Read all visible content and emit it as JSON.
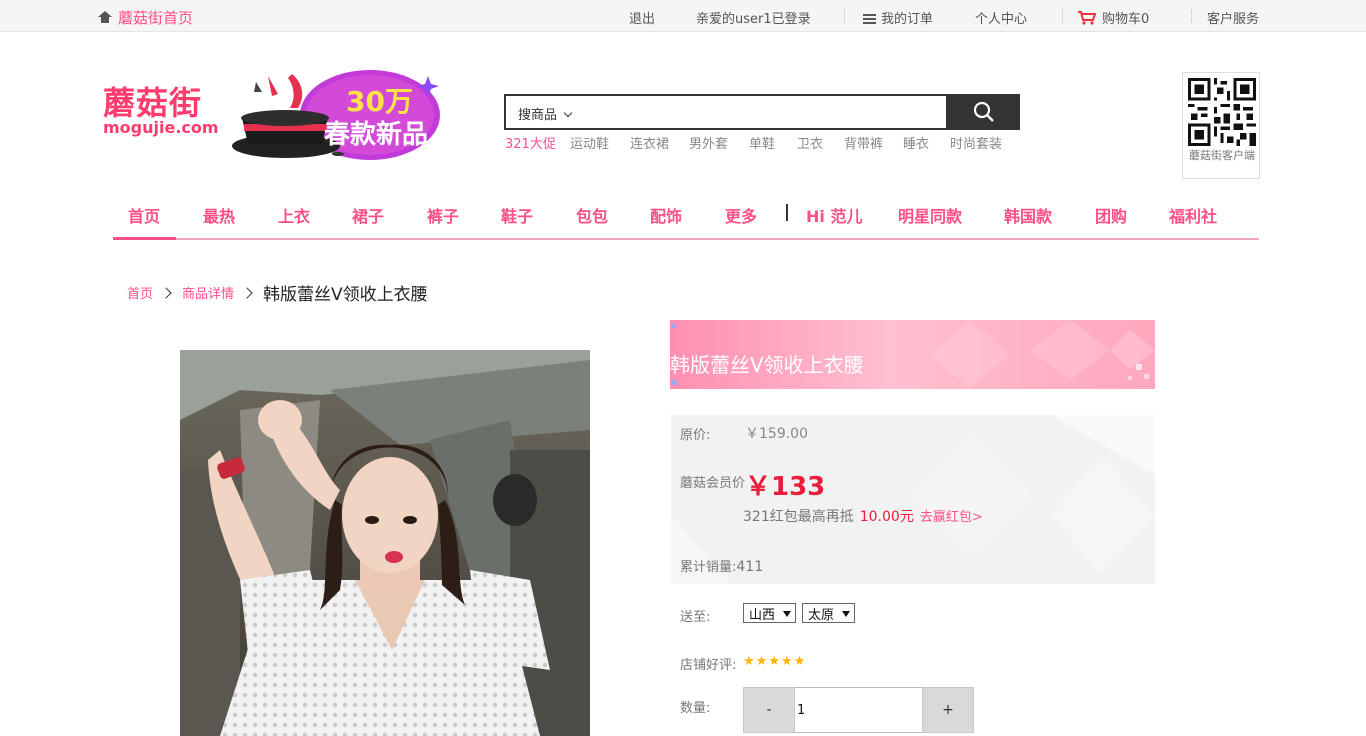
{
  "topbar": {
    "home_label": "蘑菇街首页",
    "logout": "退出",
    "greeting": "亲爱的user1已登录",
    "my_orders": "我的订单",
    "user_center": "个人中心",
    "cart": "购物车0",
    "customer_service": "客户服务"
  },
  "header": {
    "logo_cn": "蘑菇街",
    "logo_en": "mogujie.com",
    "promo_line1": "30万",
    "promo_line2": "春款新品",
    "search_scope": "搜商品",
    "hot_words": [
      "321大促",
      "运动鞋",
      "连衣裙",
      "男外套",
      "单鞋",
      "卫衣",
      "背带裤",
      "睡衣",
      "时尚套装"
    ],
    "qr_label": "蘑菇街客户端"
  },
  "nav": {
    "items": [
      "首页",
      "最热",
      "上衣",
      "裙子",
      "裤子",
      "鞋子",
      "包包",
      "配饰",
      "更多",
      "Hi 范儿",
      "明星同款",
      "韩国款",
      "团购",
      "福利社"
    ]
  },
  "breadcrumb": {
    "home": "首页",
    "detail": "商品详情",
    "current": "韩版蕾丝V领收上衣腰"
  },
  "product": {
    "title": "韩版蕾丝V领收上衣腰",
    "original_price_label": "原价:",
    "original_price": "￥159.00",
    "vip_price_label": "蘑菇会员价",
    "vip_price": "￥133",
    "redpack_text": "321红包最高再抵",
    "redpack_amount": "10.00元",
    "redpack_link": "去赢红包>",
    "sales_label": "累计销量:",
    "sales_value": "411",
    "ship_to_label": "送至:",
    "province": "山西",
    "city": "太原",
    "rating_label": "店铺好评:",
    "rating_stars": 5,
    "quantity_label": "数量:",
    "quantity_value": "1",
    "minus_label": "-",
    "plus_label": "+"
  },
  "colors": {
    "brand_pink": "#ff4f87",
    "price_red": "#e81e3b",
    "topbar_bg": "#f5f5f5"
  }
}
